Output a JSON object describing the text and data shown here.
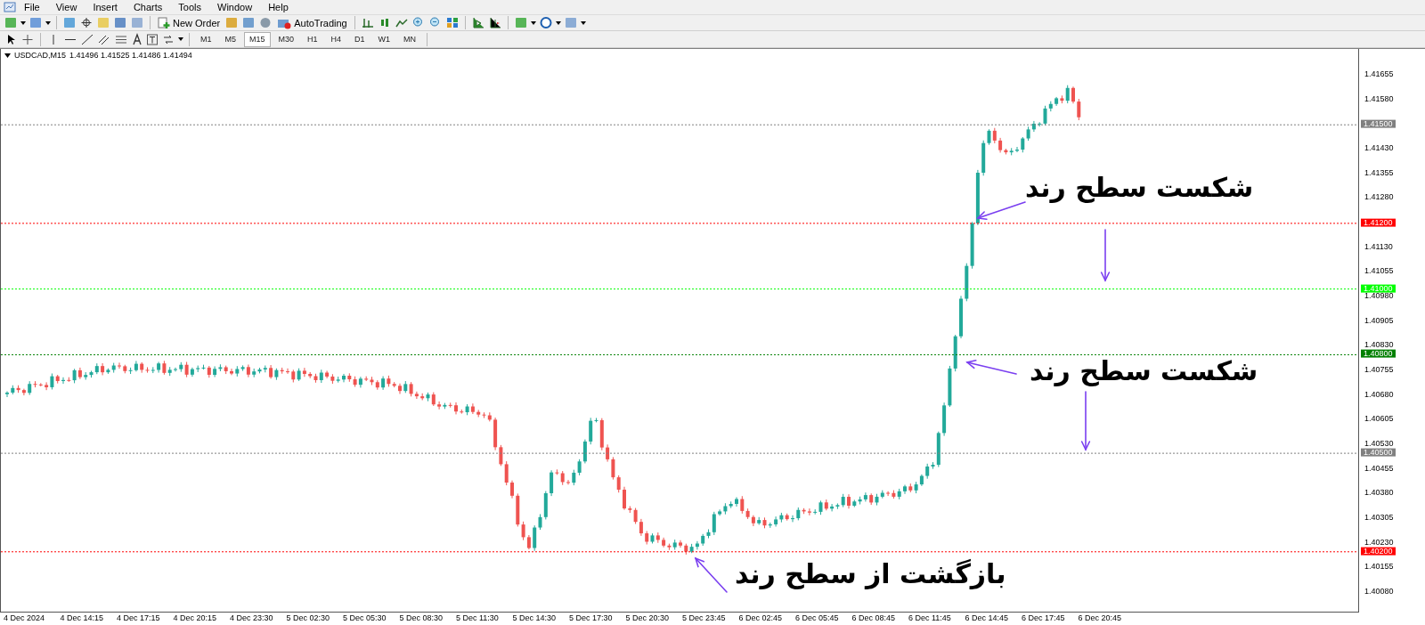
{
  "menu": [
    "File",
    "View",
    "Insert",
    "Charts",
    "Tools",
    "Window",
    "Help"
  ],
  "toolbar": {
    "new_order": "New Order",
    "auto_trading": "AutoTrading"
  },
  "timeframes": [
    {
      "label": "M1",
      "selected": false
    },
    {
      "label": "M5",
      "selected": false
    },
    {
      "label": "M15",
      "selected": true
    },
    {
      "label": "M30",
      "selected": false
    },
    {
      "label": "H1",
      "selected": false
    },
    {
      "label": "H4",
      "selected": false
    },
    {
      "label": "D1",
      "selected": false
    },
    {
      "label": "W1",
      "selected": false
    },
    {
      "label": "MN",
      "selected": false
    }
  ],
  "chart": {
    "symbol": "USDCAD,M15",
    "ohlc": "1.41496 1.41525 1.41486 1.41494",
    "price_ticks": [
      "1.41655",
      "1.41580",
      "1.41430",
      "1.41355",
      "1.41280",
      "1.41130",
      "1.41055",
      "1.40980",
      "1.40905",
      "1.40830",
      "1.40755",
      "1.40680",
      "1.40605",
      "1.40530",
      "1.40455",
      "1.40380",
      "1.40305",
      "1.40230",
      "1.40155",
      "1.40080"
    ],
    "levels": [
      {
        "label": "1.41500",
        "color": "#808080"
      },
      {
        "label": "1.41200",
        "color": "#ff0000"
      },
      {
        "label": "1.41000",
        "color": "#00ff00"
      },
      {
        "label": "1.40800",
        "color": "#008000"
      },
      {
        "label": "1.40500",
        "color": "#808080"
      },
      {
        "label": "1.40200",
        "color": "#ff0000"
      }
    ],
    "time_labels": [
      "4 Dec 2024",
      "4 Dec 14:15",
      "4 Dec 17:15",
      "4 Dec 20:15",
      "4 Dec 23:30",
      "5 Dec 02:30",
      "5 Dec 05:30",
      "5 Dec 08:30",
      "5 Dec 11:30",
      "5 Dec 14:30",
      "5 Dec 17:30",
      "5 Dec 20:30",
      "5 Dec 23:45",
      "6 Dec 02:45",
      "6 Dec 05:45",
      "6 Dec 08:45",
      "6 Dec 11:45",
      "6 Dec 14:45",
      "6 Dec 17:45",
      "6 Dec 20:45"
    ],
    "annotations": [
      {
        "text": "شکست سطح رند"
      },
      {
        "text": "شکست سطح رند"
      },
      {
        "text": "بازگشت از سطح رند"
      }
    ]
  }
}
